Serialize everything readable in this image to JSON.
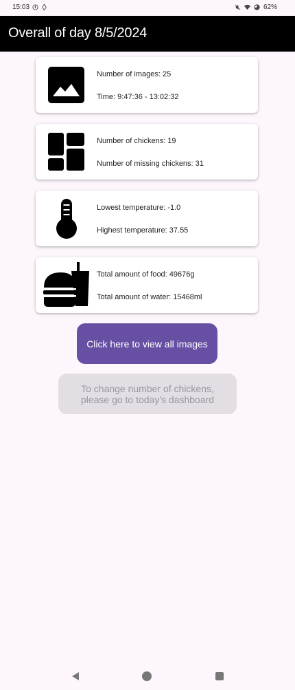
{
  "status_bar": {
    "time": "15:03",
    "battery": "62%",
    "icons": [
      "notification-icon",
      "sync-icon",
      "mute-icon",
      "wifi-icon",
      "battery-icon"
    ]
  },
  "app_bar": {
    "title": "Overall of day 8/5/2024"
  },
  "cards": [
    {
      "icon": "image-icon",
      "line1": "Number of images: 25",
      "line2": "Time: 9:47:36 - 13:02:32"
    },
    {
      "icon": "dashboard-icon",
      "line1": "Number of chickens: 19",
      "line2": "Number of missing chickens: 31"
    },
    {
      "icon": "thermometer-icon",
      "line1": "Lowest temperature: -1.0",
      "line2": "Highest temperature: 37.55"
    },
    {
      "icon": "food-drink-icon",
      "line1": "Total amount of food: 49676g",
      "line2": "Total amount of water: 15468ml"
    }
  ],
  "view_images_button": {
    "label": "Click here to view all images"
  },
  "change_chickens_notice": {
    "line1": "To change number of chickens,",
    "line2": "please go to today's dashboard"
  },
  "nav_bar": {
    "icons": [
      "back-icon",
      "home-icon",
      "recents-icon"
    ]
  }
}
